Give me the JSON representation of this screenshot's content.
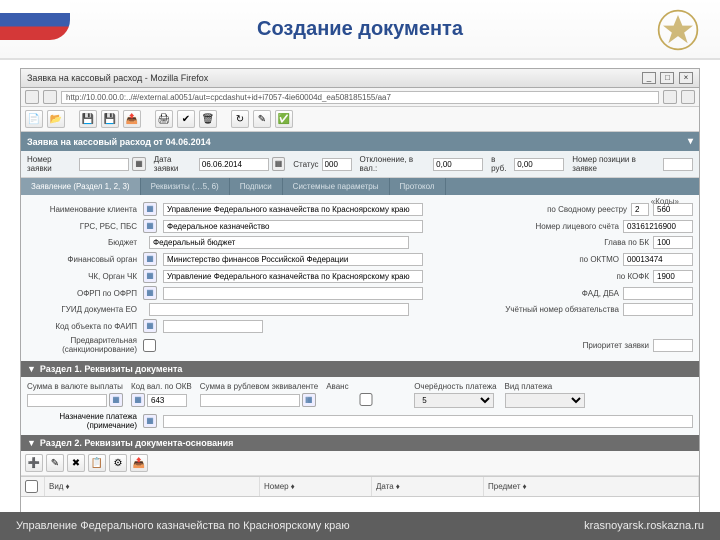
{
  "slide": {
    "title": "Создание документа"
  },
  "browser": {
    "title": "Заявка на кассовый расход - Mozilla Firefox",
    "url": "http://10.00.00.0:../#/external.a0051/aut=cpcdashut+id+i7057-4ie60004d_ea508185155/aa7"
  },
  "doc": {
    "header": "Заявка на кассовый расход от 04.06.2014",
    "num_label": "Номер заявки",
    "num": "",
    "date_label": "Дата заявки",
    "date": "06.06.2014",
    "status_label": "Статус",
    "status": "000",
    "otkl_label": "Отклонение, в вал.:",
    "otkl": "0,00",
    "rub_label": "в руб.",
    "rub": "0,00",
    "lineno_label": "Номер позиции в заявке"
  },
  "tabs": {
    "t1": "Заявление (Раздел 1, 2, 3)",
    "t2": "Реквизиты (…5, 6)",
    "t3": "Подписи",
    "t4": "Системные параметры",
    "t5": "Протокол"
  },
  "form": {
    "codes_label": "«Коды»",
    "client_label": "Наименование клиента",
    "client_val": "Управление Федерального казначейства по Красноярскому краю",
    "r1_label": "по Сводному реестру",
    "r1_val1": "2",
    "r1_val2": "560",
    "grs_label": "ГРС, РБС, ПБС",
    "grs_val": "Федеральное казначейство",
    "r2_label": "Номер лицевого счёта",
    "r2_val": "03161216900",
    "budget_label": "Бюджет",
    "budget_val": "Федеральный бюджет",
    "r3_label": "Глава по БК",
    "r3_val": "100",
    "fin_label": "Финансовый орган",
    "fin_val": "Министерство финансов Российской Федерации",
    "r4_label": "по ОКТМО",
    "r4_val": "00013474",
    "chk_label": "ЧК, Орган ЧК",
    "chk_val": "Управление Федерального казначейства по Красноярскому краю",
    "r5_label": "по КОФК",
    "r5_val": "1900",
    "ofrp_label": "ОФРП по ОФРП",
    "r6_label": "ФАД, ДБА",
    "guid_label": "ГУИД документа ЕО",
    "r7_label": "Учётный номер обязательства",
    "kod_label": "Код объекта по ФАИП",
    "pred_label": "Предварительная (санкционирование)",
    "prio_label": "Приоритет заявки"
  },
  "sec1": {
    "title": "Раздел 1. Реквизиты документа",
    "sum_val_label": "Сумма в валюте выплаты",
    "kod_okb_label": "Код вал. по ОКВ",
    "kod_okb_val": "643",
    "sum_rub_label": "Сумма в рублевом эквиваленте",
    "sum_rub_val": "",
    "avans_label": "Аванс",
    "ochered_label": "Очерёдность платежа",
    "ochered_val": "5",
    "vid_label": "Вид платежа",
    "nazn_label": "Назначение платежа (примечание)"
  },
  "sec2": {
    "title": "Раздел 2. Реквизиты документа-основания",
    "col_vid": "Вид",
    "col_num": "Номер",
    "col_date": "Дата",
    "col_pred": "Предмет"
  },
  "footer": {
    "org": "Управление Федерального казначейства по Красноярскому краю",
    "site": "krasnoyarsk.roskazna.ru"
  }
}
